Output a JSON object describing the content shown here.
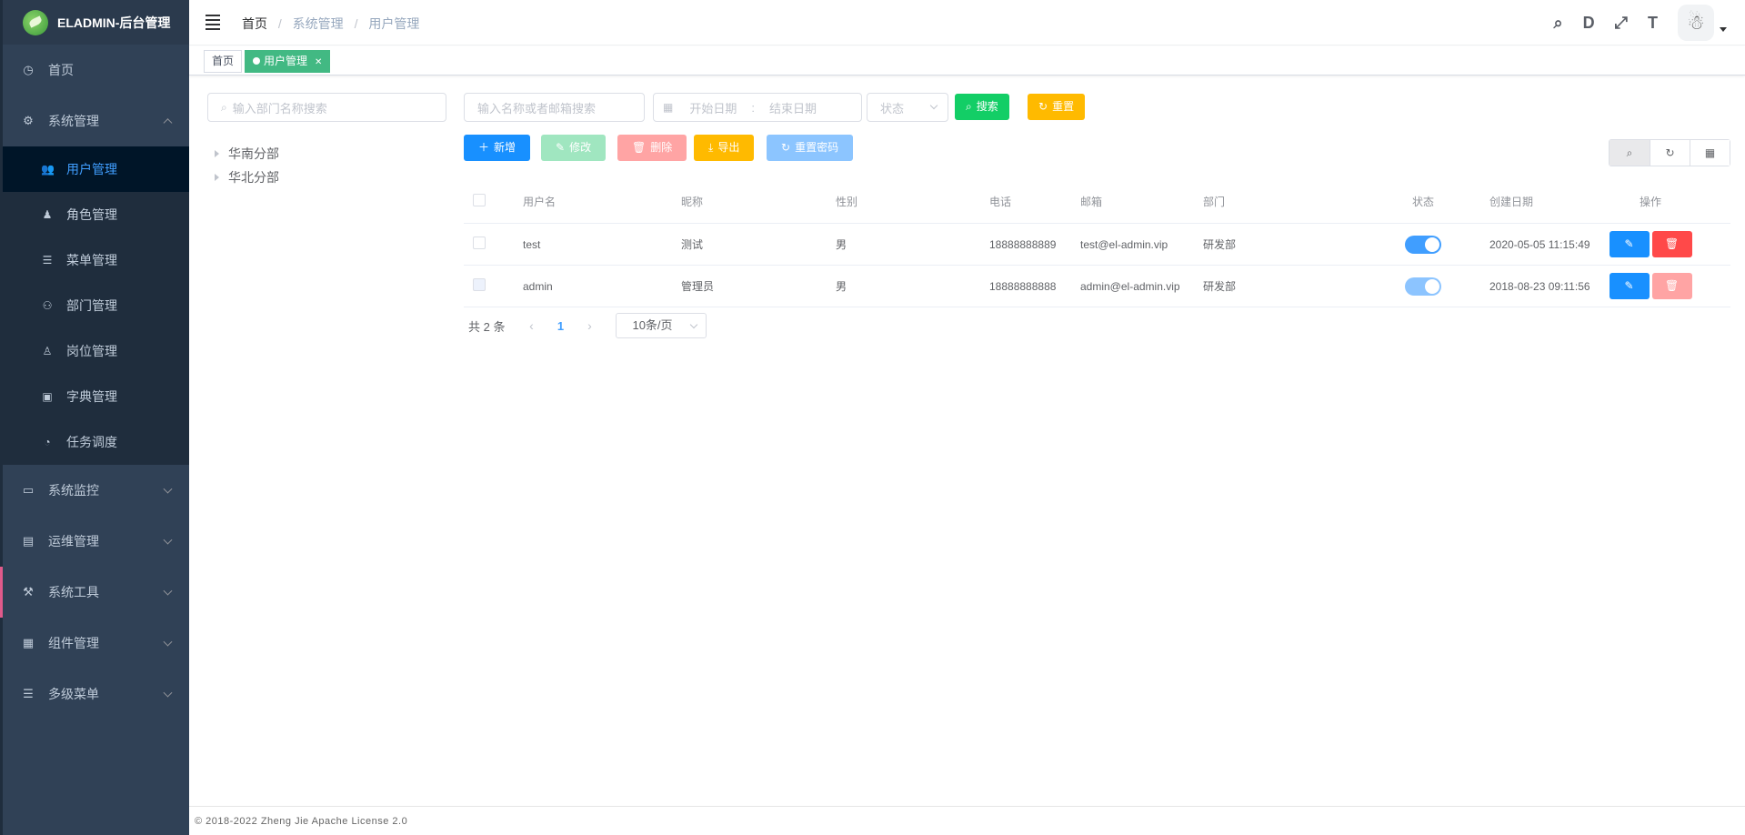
{
  "app": {
    "title": "ELADMIN-后台管理"
  },
  "sidebar": {
    "items": [
      {
        "label": "首页",
        "icon": "dashboard-icon"
      },
      {
        "label": "系统管理",
        "icon": "gear-icon",
        "expanded": true
      },
      {
        "label": "系统监控",
        "icon": "monitor-icon"
      },
      {
        "label": "运维管理",
        "icon": "server-icon"
      },
      {
        "label": "系统工具",
        "icon": "tools-icon"
      },
      {
        "label": "组件管理",
        "icon": "grid-icon"
      },
      {
        "label": "多级菜单",
        "icon": "list-icon"
      }
    ],
    "sub_items": [
      {
        "label": "用户管理",
        "icon": "user-icon",
        "active": true
      },
      {
        "label": "角色管理",
        "icon": "role-icon"
      },
      {
        "label": "菜单管理",
        "icon": "menu-icon"
      },
      {
        "label": "部门管理",
        "icon": "dept-icon"
      },
      {
        "label": "岗位管理",
        "icon": "post-icon"
      },
      {
        "label": "字典管理",
        "icon": "dict-icon"
      },
      {
        "label": "任务调度",
        "icon": "timer-icon"
      }
    ]
  },
  "breadcrumb": [
    "首页",
    "系统管理",
    "用户管理"
  ],
  "tags": [
    {
      "label": "首页"
    },
    {
      "label": "用户管理",
      "active": true
    }
  ],
  "filters": {
    "dept_placeholder": "输入部门名称搜索",
    "name_placeholder": "输入名称或者邮箱搜索",
    "start_date": "开始日期",
    "date_sep": ":",
    "end_date": "结束日期",
    "status_placeholder": "状态",
    "search": "搜索",
    "reset": "重置"
  },
  "toolbar": {
    "add": "新增",
    "edit": "修改",
    "delete": "删除",
    "export": "导出",
    "reset_pwd": "重置密码"
  },
  "tree": [
    "华南分部",
    "华北分部"
  ],
  "table": {
    "headers": [
      "用户名",
      "昵称",
      "性别",
      "电话",
      "邮箱",
      "部门",
      "状态",
      "创建日期",
      "操作"
    ],
    "rows": [
      {
        "username": "test",
        "nickname": "测试",
        "gender": "男",
        "phone": "18888888889",
        "email": "test@el-admin.vip",
        "dept": "研发部",
        "enabled": true,
        "created": "2020-05-05 11:15:49"
      },
      {
        "username": "admin",
        "nickname": "管理员",
        "gender": "男",
        "phone": "18888888888",
        "email": "admin@el-admin.vip",
        "dept": "研发部",
        "enabled": true,
        "created": "2018-08-23 09:11:56"
      }
    ]
  },
  "pagination": {
    "total": "共 2 条",
    "page": "1",
    "size": "10条/页"
  },
  "footer": "© 2018-2022 Zheng Jie Apache License 2.0",
  "colors": {
    "sidebar_bg": "#304156",
    "primary": "#1890ff",
    "success": "#13ce66",
    "warning": "#ffba00",
    "danger": "#ff4949",
    "tag_active": "#42b983"
  }
}
